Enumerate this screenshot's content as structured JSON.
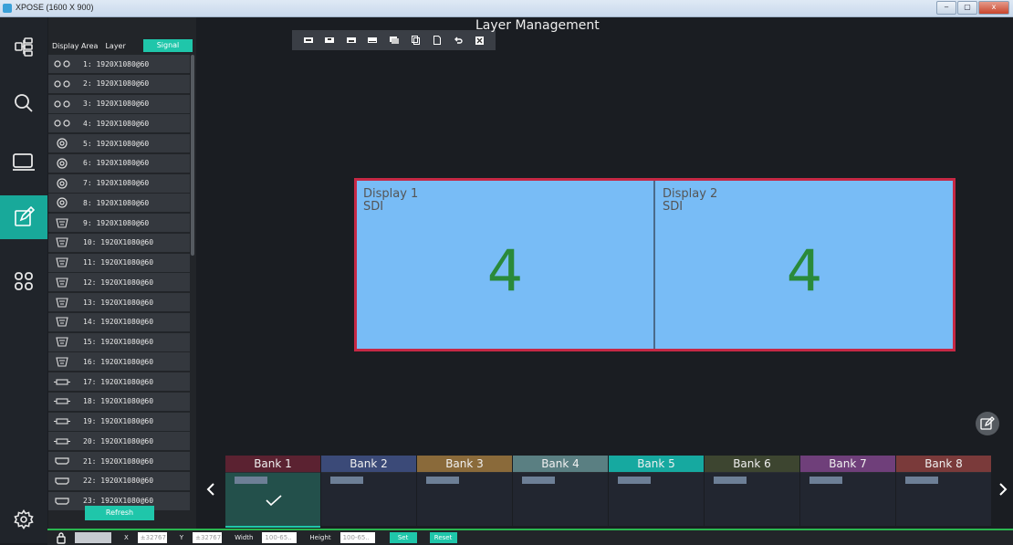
{
  "window": {
    "title": "XPOSE (1600 X 900)",
    "min": "‒",
    "max": "▢",
    "close": "x"
  },
  "main_title": "Layer Management",
  "left_nav": [
    "layout-icon",
    "search-icon",
    "monitor-icon",
    "edit-icon",
    "apps-icon",
    "settings-icon"
  ],
  "panel": {
    "tabs": {
      "display_area": "Display Area",
      "layer": "Layer",
      "signal": "Signal"
    },
    "signals": [
      {
        "label": "1: 1920X1080@60",
        "icon": "dual-dot-icon"
      },
      {
        "label": "2: 1920X1080@60",
        "icon": "dual-dot-icon"
      },
      {
        "label": "3: 1920X1080@60",
        "icon": "dual-dot-icon"
      },
      {
        "label": "4: 1920X1080@60",
        "icon": "dual-dot-icon"
      },
      {
        "label": "5: 1920X1080@60",
        "icon": "round-port-icon"
      },
      {
        "label": "6: 1920X1080@60",
        "icon": "round-port-icon"
      },
      {
        "label": "7: 1920X1080@60",
        "icon": "round-port-icon"
      },
      {
        "label": "8: 1920X1080@60",
        "icon": "round-port-icon"
      },
      {
        "label": "9: 1920X1080@60",
        "icon": "vga-port-icon"
      },
      {
        "label": "10: 1920X1080@60",
        "icon": "vga-port-icon"
      },
      {
        "label": "11: 1920X1080@60",
        "icon": "vga-port-icon"
      },
      {
        "label": "12: 1920X1080@60",
        "icon": "vga-port-icon"
      },
      {
        "label": "13: 1920X1080@60",
        "icon": "vga-port-icon"
      },
      {
        "label": "14: 1920X1080@60",
        "icon": "vga-port-icon"
      },
      {
        "label": "15: 1920X1080@60",
        "icon": "vga-port-icon"
      },
      {
        "label": "16: 1920X1080@60",
        "icon": "vga-port-icon"
      },
      {
        "label": "17: 1920X1080@60",
        "icon": "hdbaset-port-icon"
      },
      {
        "label": "18: 1920X1080@60",
        "icon": "hdbaset-port-icon"
      },
      {
        "label": "19: 1920X1080@60",
        "icon": "hdbaset-port-icon"
      },
      {
        "label": "20: 1920X1080@60",
        "icon": "hdbaset-port-icon"
      },
      {
        "label": "21: 1920X1080@60",
        "icon": "hdmi-port-icon"
      },
      {
        "label": "22: 1920X1080@60",
        "icon": "hdmi-port-icon"
      },
      {
        "label": "23: 1920X1080@60",
        "icon": "hdmi-port-icon"
      }
    ],
    "refresh": "Refresh"
  },
  "displays": [
    {
      "name": "Display 1",
      "source": "SDI",
      "number": "4"
    },
    {
      "name": "Display 2",
      "source": "SDI",
      "number": "4"
    }
  ],
  "banks": [
    {
      "label": "Bank 1",
      "color": "#5b2231",
      "selected": true
    },
    {
      "label": "Bank 2",
      "color": "#3b4a78",
      "selected": false
    },
    {
      "label": "Bank 3",
      "color": "#8a6a3a",
      "selected": false
    },
    {
      "label": "Bank 4",
      "color": "#5a7f82",
      "selected": false
    },
    {
      "label": "Bank 5",
      "color": "#16a9a0",
      "selected": false
    },
    {
      "label": "Bank 6",
      "color": "#3d4530",
      "selected": false
    },
    {
      "label": "Bank 7",
      "color": "#6f3f7a",
      "selected": false
    },
    {
      "label": "Bank 8",
      "color": "#7a3a3a",
      "selected": false
    }
  ],
  "bottom": {
    "x_label": "X",
    "x_ph": "±32767",
    "y_label": "Y",
    "y_ph": "±32767",
    "w_label": "Width",
    "w_ph": "100-65..",
    "h_label": "Height",
    "h_ph": "100-65..",
    "set": "Set",
    "reset": "Reset"
  },
  "colors": {
    "accent": "#1fc6aa",
    "frame": "#c62845",
    "display_bg": "#78bcf6",
    "number": "#2a8a3a"
  }
}
